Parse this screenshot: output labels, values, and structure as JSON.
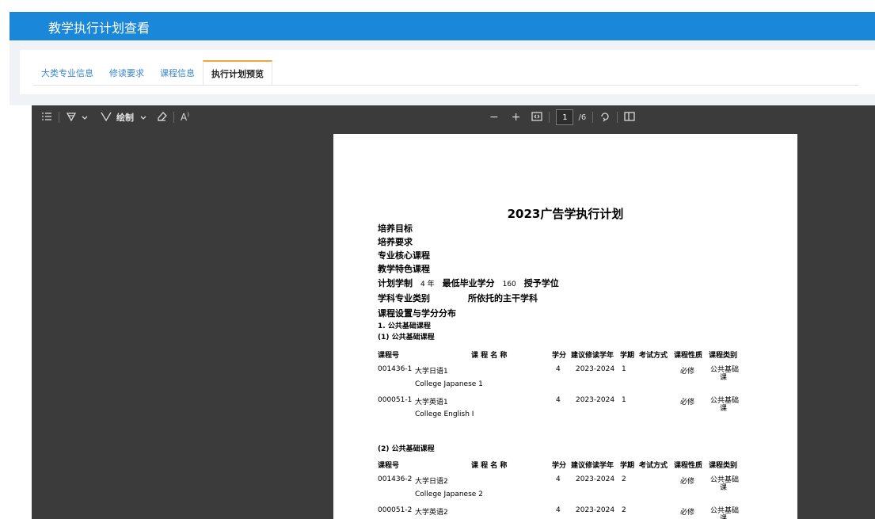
{
  "header": {
    "title": "教学执行计划查看"
  },
  "tabs": [
    {
      "label": "大类专业信息",
      "active": false
    },
    {
      "label": "修读要求",
      "active": false
    },
    {
      "label": "课程信息",
      "active": false
    },
    {
      "label": "执行计划预览",
      "active": true
    }
  ],
  "toolbar": {
    "icons": [
      "list-icon",
      "highlight-icon",
      "chevron-down-icon",
      "draw-icon",
      "eraser-icon",
      "read-aloud-icon",
      "zoom-out-icon",
      "zoom-in-icon",
      "fit-page-icon",
      "rotate-icon",
      "page-view-icon"
    ],
    "draw_label": "绘制",
    "read_aloud_label": "A",
    "zoom_out": "−",
    "zoom_in": "+",
    "page_current": "1",
    "page_total": "/6"
  },
  "document": {
    "title": "2023广告学执行计划",
    "sections": {
      "goal": "培养目标",
      "req": "培养要求",
      "core": "专业核心课程",
      "feature": "教学特色课程"
    },
    "plan_years_label": "计划学制",
    "plan_years_value": "4 年",
    "min_credits_label": "最低毕业学分",
    "min_credits_value": "160",
    "degree_label": "授予学位",
    "category_label": "学科专业类别",
    "main_subject_label": "所依托的主干学科",
    "distribution_label": "课程设置与学分分布",
    "group1": "1. 公共基础课程",
    "subgroup1": "(1) 公共基础课程",
    "subgroup2": "(2) 公共基础课程",
    "table_headers": {
      "code": "课程号",
      "name": "课 程 名 称",
      "credit": "学分",
      "year": "建议修读学年",
      "term": "学期",
      "exam": "考试方式",
      "nature": "课程性质",
      "category": "课程类别"
    },
    "rows1": [
      {
        "code": "001436-1",
        "name": "大学日语1",
        "name_en": "College Japanese 1",
        "credit": "4",
        "year": "2023-2024",
        "term": "1",
        "nature": "必修",
        "category1": "公共基础",
        "category2": "课"
      },
      {
        "code": "000051-1",
        "name": "大学英语1",
        "name_en": "College English Ⅰ",
        "credit": "4",
        "year": "2023-2024",
        "term": "1",
        "nature": "必修",
        "category1": "公共基础",
        "category2": "课"
      }
    ],
    "rows2": [
      {
        "code": "001436-2",
        "name": "大学日语2",
        "name_en": "College Japanese 2",
        "credit": "4",
        "year": "2023-2024",
        "term": "2",
        "nature": "必修",
        "category1": "公共基础",
        "category2": "课"
      },
      {
        "code": "000051-2",
        "name": "大学英语2",
        "credit": "4",
        "year": "2023-2024",
        "term": "2",
        "nature": "必修",
        "category1": "公共基础",
        "category2": "课"
      }
    ]
  }
}
